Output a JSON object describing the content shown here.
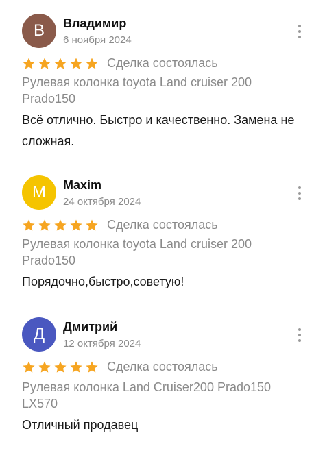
{
  "reviews": [
    {
      "avatar_letter": "В",
      "avatar_color": "#8a5a4a",
      "name": "Владимир",
      "date": "6 ноября 2024",
      "rating": 5,
      "status": "Сделка состоялась",
      "product": "Рулевая колонка toyota Land cruiser 200 Prado150",
      "text": "Всё отлично. Быстро и качественно. Замена не сложная."
    },
    {
      "avatar_letter": "M",
      "avatar_color": "#f5c400",
      "name": "Maxim",
      "date": "24 октября 2024",
      "rating": 5,
      "status": "Сделка состоялась",
      "product": "Рулевая колонка toyota Land cruiser 200 Prado150",
      "text": "Порядочно,быстро,советую!"
    },
    {
      "avatar_letter": "Д",
      "avatar_color": "#4a58c0",
      "name": "Дмитрий",
      "date": "12 октября 2024",
      "rating": 5,
      "status": "Сделка состоялась",
      "product": "Рулевая колонка Land Cruiser200 Prado150 LX570",
      "text": "Отличный продавец"
    }
  ],
  "star_color": "#f6a521"
}
